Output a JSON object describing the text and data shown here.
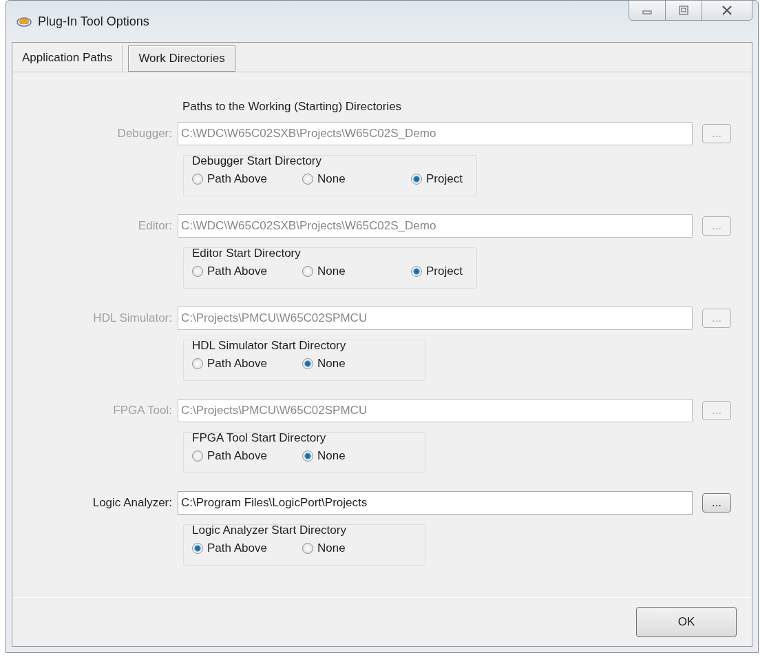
{
  "window": {
    "title": "Plug-In Tool Options"
  },
  "tabs": [
    {
      "label": "Application Paths",
      "selected": false
    },
    {
      "label": "Work Directories",
      "selected": true
    }
  ],
  "heading": "Paths to the Working (Starting) Directories",
  "rows": [
    {
      "label": "Debugger:",
      "value": "C:\\WDC\\W65C02SXB\\Projects\\W65C02S_Demo",
      "disabled": true,
      "browse": "...",
      "group": {
        "title": "Debugger Start Directory",
        "options": [
          {
            "label": "Path Above",
            "selected": false
          },
          {
            "label": "None",
            "selected": false
          },
          {
            "label": "Project",
            "selected": true
          }
        ]
      }
    },
    {
      "label": "Editor:",
      "value": "C:\\WDC\\W65C02SXB\\Projects\\W65C02S_Demo",
      "disabled": true,
      "browse": "...",
      "group": {
        "title": "Editor Start Directory",
        "options": [
          {
            "label": "Path Above",
            "selected": false
          },
          {
            "label": "None",
            "selected": false
          },
          {
            "label": "Project",
            "selected": true
          }
        ]
      }
    },
    {
      "label": "HDL Simulator:",
      "value": "C:\\Projects\\PMCU\\W65C02SPMCU",
      "disabled": true,
      "browse": "...",
      "group": {
        "title": "HDL Simulator Start Directory",
        "options": [
          {
            "label": "Path Above",
            "selected": false
          },
          {
            "label": "None",
            "selected": true
          }
        ]
      }
    },
    {
      "label": "FPGA Tool:",
      "value": "C:\\Projects\\PMCU\\W65C02SPMCU",
      "disabled": true,
      "browse": "...",
      "group": {
        "title": "FPGA Tool Start Directory",
        "options": [
          {
            "label": "Path Above",
            "selected": false
          },
          {
            "label": "None",
            "selected": true
          }
        ]
      }
    },
    {
      "label": "Logic Analyzer:",
      "value": "C:\\Program Files\\LogicPort\\Projects",
      "disabled": false,
      "browse": "...",
      "group": {
        "title": "Logic Analyzer Start Directory",
        "options": [
          {
            "label": "Path Above",
            "selected": true
          },
          {
            "label": "None",
            "selected": false
          }
        ]
      }
    }
  ],
  "buttons": [
    "OK"
  ]
}
